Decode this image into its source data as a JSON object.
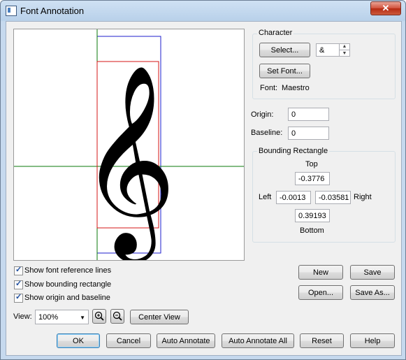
{
  "window": {
    "title": "Font Annotation",
    "close_glyph": "✕"
  },
  "character": {
    "group_label": "Character",
    "select_label": "Select...",
    "char_value": "&",
    "set_font_label": "Set Font...",
    "font_label": "Font:",
    "font_value": "Maestro"
  },
  "origin": {
    "label": "Origin:",
    "value": "0"
  },
  "baseline": {
    "label": "Baseline:",
    "value": "0"
  },
  "bounding": {
    "group_label": "Bounding Rectangle",
    "top_label": "Top",
    "top_value": "-0.3776",
    "left_label": "Left",
    "left_value": "-0.0013",
    "right_label": "Right",
    "right_value": "-0.03581",
    "bottom_value": "0.39193",
    "bottom_label": "Bottom"
  },
  "checks": {
    "reference_lines": "Show font reference lines",
    "bounding_rect": "Show bounding rectangle",
    "origin_baseline": "Show origin and baseline"
  },
  "view": {
    "label": "View:",
    "zoom_value": "100%",
    "center_label": "Center View"
  },
  "buttons": {
    "new": "New",
    "save": "Save",
    "open": "Open...",
    "save_as": "Save As...",
    "ok": "OK",
    "cancel": "Cancel",
    "auto_annotate": "Auto Annotate",
    "auto_annotate_all": "Auto Annotate All",
    "reset": "Reset",
    "help": "Help"
  },
  "glyph": {
    "symbol": "𝄞",
    "name": "treble-clef"
  },
  "colors": {
    "reference_line": "#0a7a0a",
    "bounding_box": "#d41414",
    "glyph_frame": "#1e1ecc"
  }
}
